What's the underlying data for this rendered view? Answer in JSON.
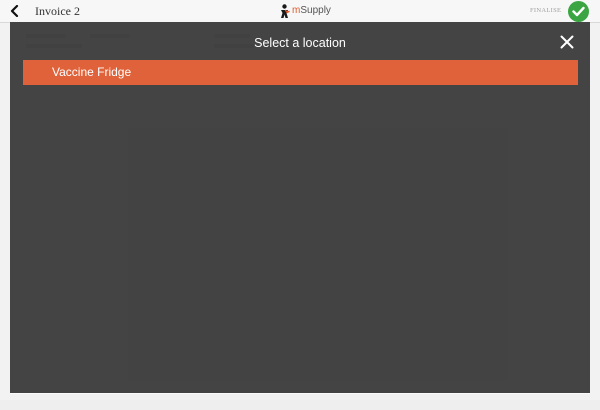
{
  "header": {
    "title": "Invoice 2",
    "back_icon": "chevron-left-icon",
    "logo": {
      "prefix": "m",
      "name": "Supply",
      "icon": "msupply-logo-icon"
    },
    "finalise_label": "FINALISE",
    "finalise_icon": "checkmark-icon"
  },
  "modal": {
    "title": "Select a location",
    "close_icon": "close-icon",
    "locations": [
      {
        "label": "Vaccine Fridge",
        "selected": true
      }
    ]
  },
  "colors": {
    "accent": "#e0623a",
    "finalise": "#3aa542",
    "overlay": "#383838"
  }
}
